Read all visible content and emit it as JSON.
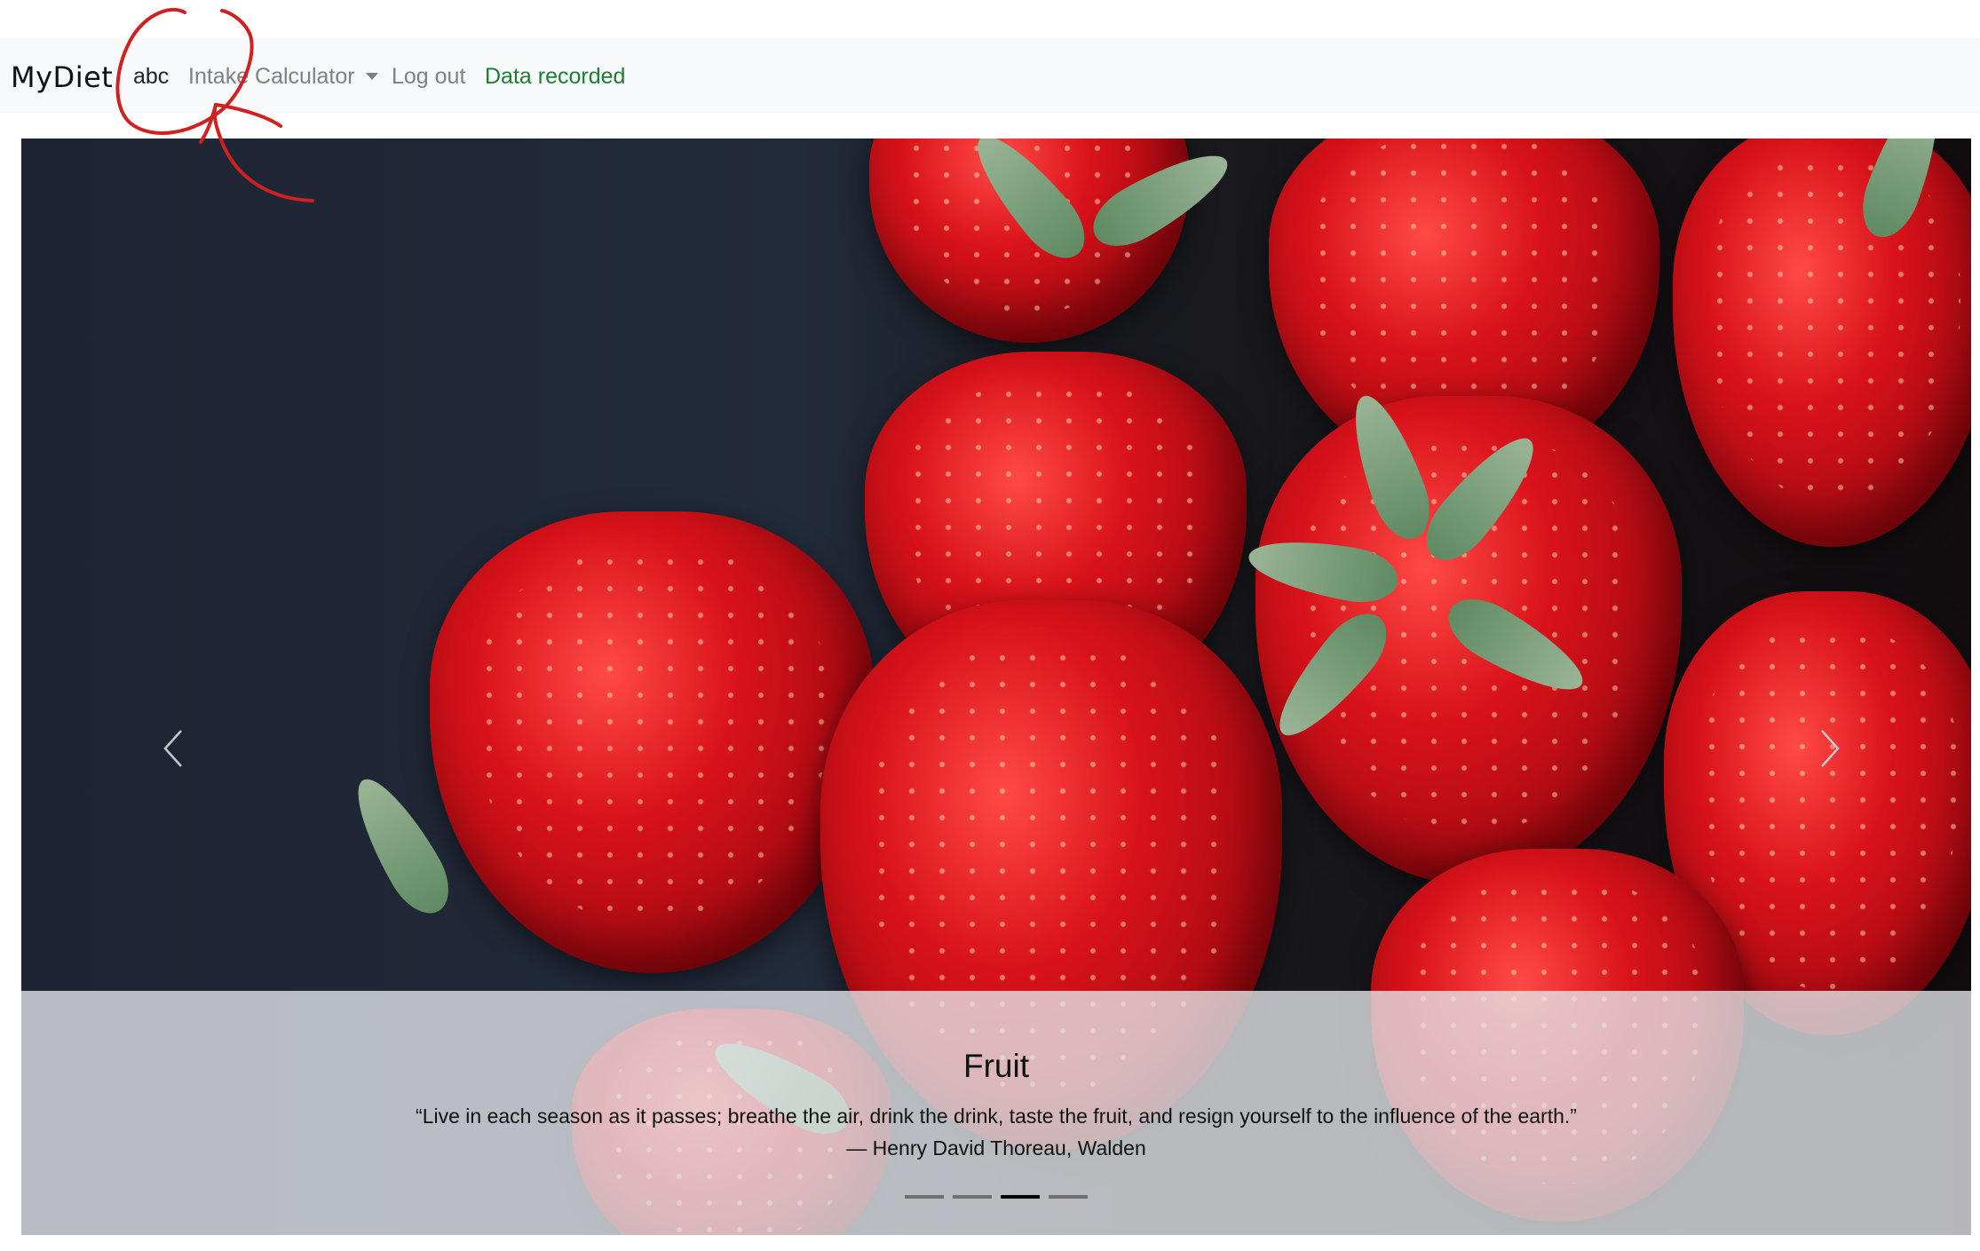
{
  "navbar": {
    "brand": "MyDiet",
    "user": "abc",
    "calculator": "Intake Calculator",
    "logout": "Log out",
    "status": "Data recorded"
  },
  "carousel": {
    "caption_title": "Fruit",
    "caption_quote": "“Live in each season as it passes; breathe the air, drink the drink, taste the fruit, and resign yourself to the influence of the earth.”",
    "caption_author": "— Henry David Thoreau, Walden",
    "slide_count": 4,
    "active_slide": 3
  },
  "colors": {
    "status": "#1e7d34",
    "annotation": "#d21f1f"
  },
  "icons": {
    "prev": "chevron-left-icon",
    "next": "chevron-right-icon",
    "dropdown": "caret-down-icon"
  }
}
